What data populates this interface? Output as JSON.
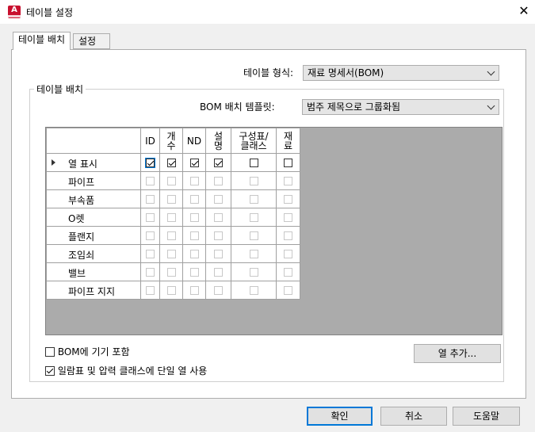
{
  "window": {
    "title": "테이블 설정",
    "close_glyph": "✕"
  },
  "tabs": [
    {
      "label": "테이블 배치"
    },
    {
      "label": "설정"
    }
  ],
  "table_format": {
    "label": "테이블 형식:",
    "value": "재료 명세서(BOM)"
  },
  "group": {
    "legend": "테이블 배치"
  },
  "bom_template": {
    "label": "BOM 배치 템플릿:",
    "value": "범주 제목으로 그룹화됨"
  },
  "grid": {
    "columns": [
      {
        "label": "ID"
      },
      {
        "label": "개\n수"
      },
      {
        "label": "ND"
      },
      {
        "label": "설\n명"
      },
      {
        "label": "구성표/\n클래스"
      },
      {
        "label": "재\n료"
      }
    ],
    "rows": [
      {
        "label": "열 표시",
        "checks": [
          true,
          true,
          true,
          true,
          false,
          false
        ],
        "enabled": true
      },
      {
        "label": "파이프",
        "checks": [
          false,
          false,
          false,
          false,
          false,
          false
        ],
        "enabled": false
      },
      {
        "label": "부속품",
        "checks": [
          false,
          false,
          false,
          false,
          false,
          false
        ],
        "enabled": false
      },
      {
        "label": "O렛",
        "checks": [
          false,
          false,
          false,
          false,
          false,
          false
        ],
        "enabled": false
      },
      {
        "label": "플랜지",
        "checks": [
          false,
          false,
          false,
          false,
          false,
          false
        ],
        "enabled": false
      },
      {
        "label": "조임쇠",
        "checks": [
          false,
          false,
          false,
          false,
          false,
          false
        ],
        "enabled": false
      },
      {
        "label": "밸브",
        "checks": [
          false,
          false,
          false,
          false,
          false,
          false
        ],
        "enabled": false
      },
      {
        "label": "파이프 지지",
        "checks": [
          false,
          false,
          false,
          false,
          false,
          false
        ],
        "enabled": false
      }
    ]
  },
  "options": {
    "include_equipment": {
      "label": "BOM에 기기 포함",
      "checked": false
    },
    "single_column": {
      "label": "일람표 및 압력 클래스에 단일 열 사용",
      "checked": true
    }
  },
  "add_column_button": "열 추가...",
  "buttons": {
    "ok": "확인",
    "cancel": "취소",
    "help": "도움말"
  },
  "colors": {
    "accent": "#0078d7",
    "grid_background": "#ababab",
    "app_icon": "#c8102e"
  }
}
